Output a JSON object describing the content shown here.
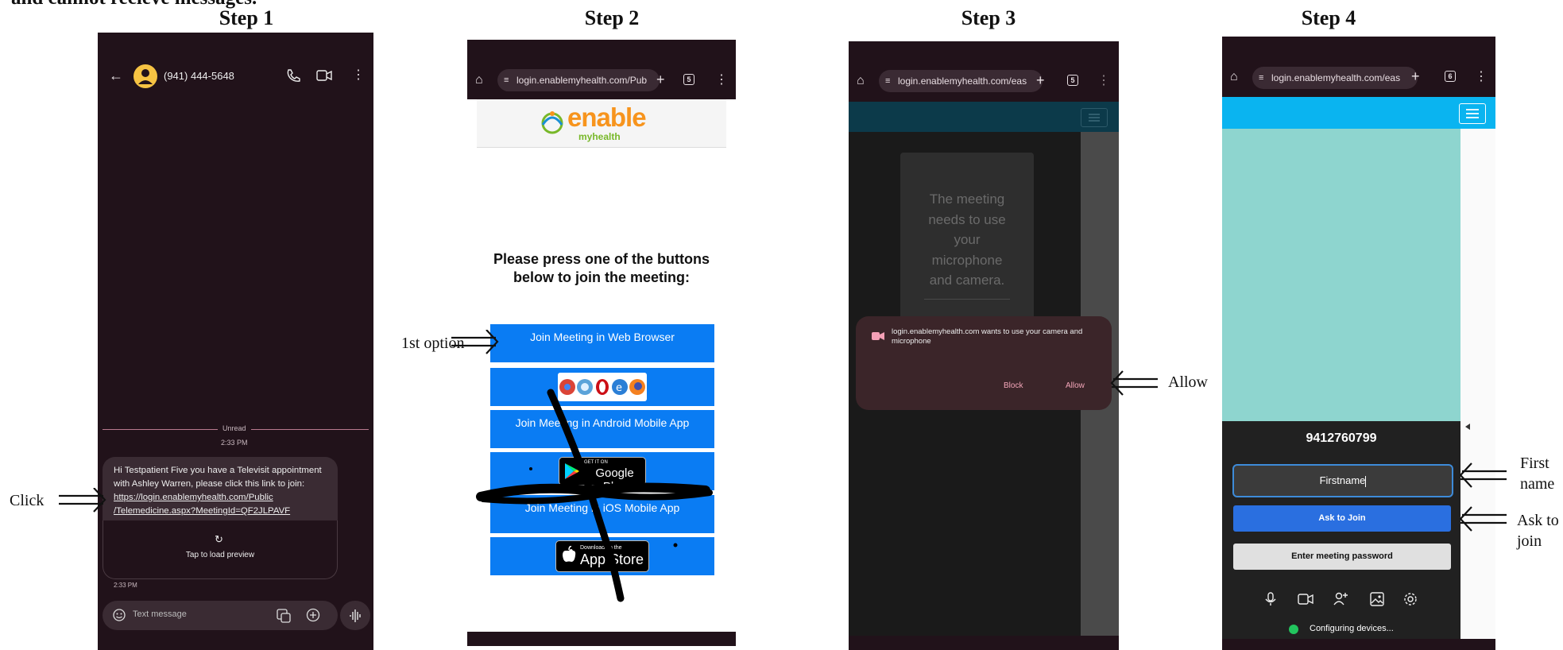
{
  "header": {
    "caption": "and cannot recieve messages."
  },
  "steps": {
    "step1": "Step 1",
    "step2": "Step 2",
    "step3": "Step 3",
    "step4": "Step 4"
  },
  "annotations": {
    "click": "Click",
    "first_option": "1st option",
    "allow": "Allow",
    "first_name_line1": "First",
    "first_name_line2": "name",
    "ask_line1": "Ask to",
    "ask_line2": "join"
  },
  "phone1": {
    "contact_number": "(941) 444-5648",
    "unread_label": "Unread",
    "time_divider": "2:33 PM",
    "message_line1": "Hi Testpatient Five you have a Televisit appointment",
    "message_line2": "with Ashley  Warren, please click this link to join:",
    "link_line1": "https://login.enablemyhealth.com/Public",
    "link_line2": "/Telemedicine.aspx?MeetingId=QF2JLPAVF",
    "preview_label": "Tap to load preview",
    "message_time": "2:33 PM",
    "input_placeholder": "Text message",
    "icons": [
      "back-arrow-icon",
      "avatar",
      "phone-icon",
      "video-icon",
      "more-vertical-icon",
      "refresh-icon",
      "emoji-icon",
      "gallery-icon",
      "add-icon",
      "voice-icon"
    ]
  },
  "phone2": {
    "url": "login.enablemyhealth.com/Pub",
    "tab_count": "5",
    "logo_main": "enable",
    "logo_sub": "myhealth",
    "heading_line1": "Please press one of the buttons",
    "heading_line2": "below to join the meeting:",
    "web_button": "Join Meeting in Web Browser",
    "android_button": "Join Meeting in Android Mobile App",
    "gplay_small": "GET IT ON",
    "gplay_big": "Google Play",
    "ios_button": "Join Meeting in iOS Mobile App",
    "appstore_small": "Download on the",
    "appstore_big": "App Store"
  },
  "phone3": {
    "url": "login.enablemyhealth.com/eas",
    "tab_count": "5",
    "card_line1": "The meeting",
    "card_line2": "needs to use",
    "card_line3": "your",
    "card_line4": "microphone",
    "card_line5": "and camera.",
    "dialog_text": "login.enablemyhealth.com wants to use your camera and microphone",
    "block_label": "Block",
    "allow_label": "Allow"
  },
  "phone4": {
    "url": "login.enablemyhealth.com/eas",
    "tab_count": "6",
    "meeting_id": "9412760799",
    "name_value": "Firstname",
    "ask_button": "Ask to Join",
    "password_button": "Enter meeting password",
    "status_text": "Configuring devices...",
    "status_color": "#22c55e"
  },
  "colors": {
    "messages_bg": "#21121a",
    "bubble": "#3a2b33",
    "browser_bar": "#21121a",
    "blue_button": "#0a7cf3",
    "cyan_header": "#0ab4f0",
    "teal_video": "#8ed5cf",
    "meet_dark": "#212121"
  }
}
